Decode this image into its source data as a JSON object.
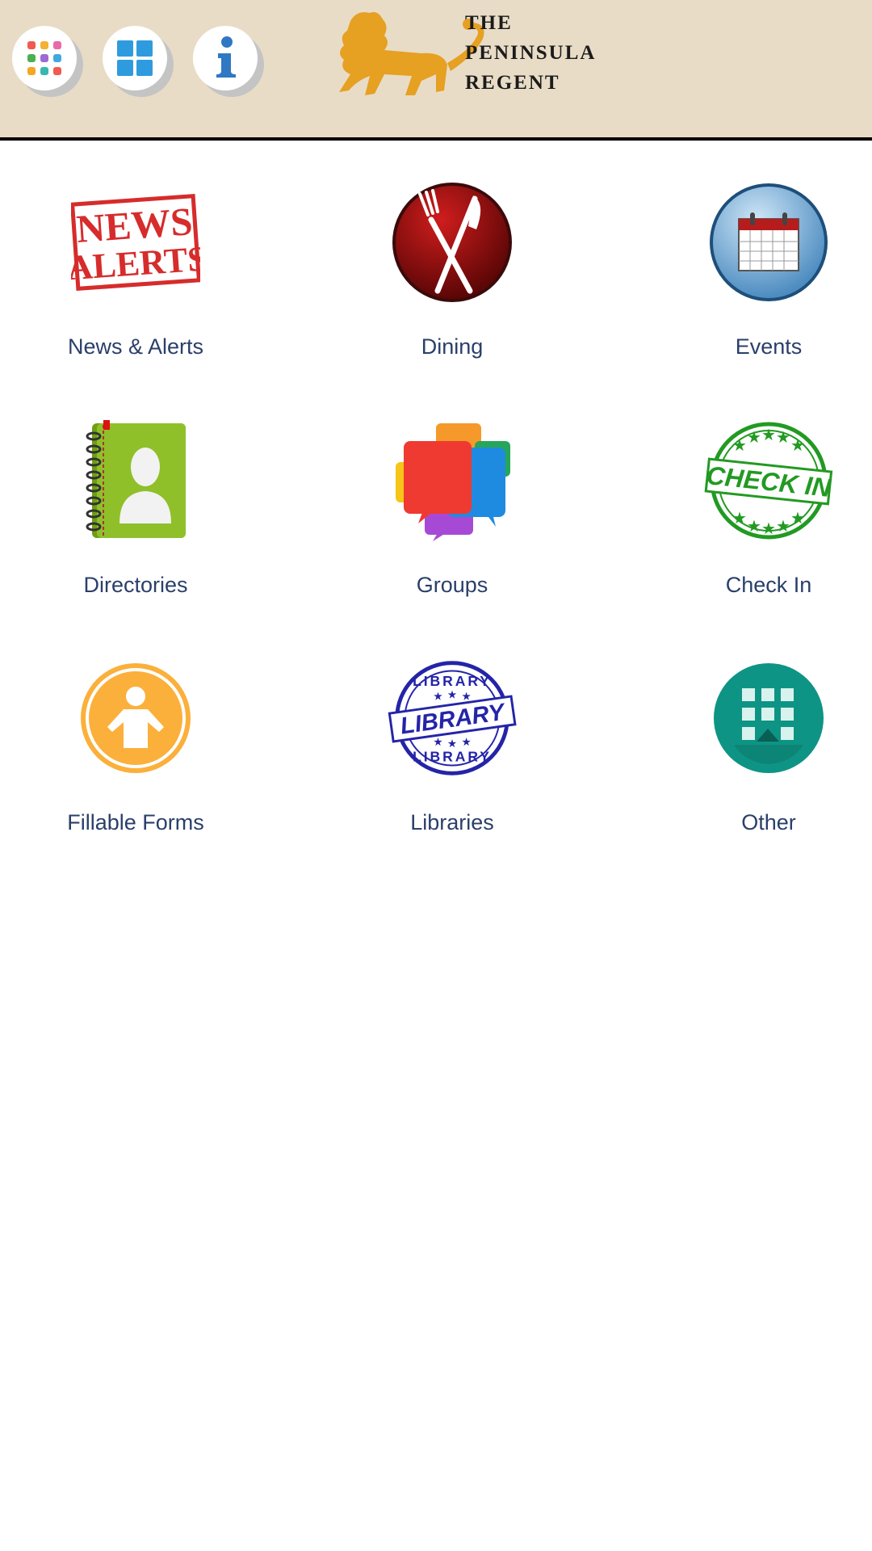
{
  "header": {
    "buttons": [
      {
        "icon": "apps-dots-icon"
      },
      {
        "icon": "grid-tiles-icon"
      },
      {
        "icon": "info-icon"
      }
    ],
    "logo_lines": [
      "THE",
      "PENINSULA",
      "REGENT"
    ],
    "logo_icon": "lion-icon",
    "background": "#e8dcc6"
  },
  "tiles": [
    {
      "label": "News & Alerts",
      "icon": "news-alerts-stamp-icon",
      "image_text": [
        "NEWS",
        "ALERTS"
      ]
    },
    {
      "label": "Dining",
      "icon": "fork-knife-icon"
    },
    {
      "label": "Events",
      "icon": "calendar-icon"
    },
    {
      "label": "Directories",
      "icon": "address-book-icon"
    },
    {
      "label": "Groups",
      "icon": "chat-bubbles-icon"
    },
    {
      "label": "Check In",
      "icon": "check-in-stamp-icon",
      "image_text": "CHECK IN"
    },
    {
      "label": "Fillable Forms",
      "icon": "person-form-icon"
    },
    {
      "label": "Libraries",
      "icon": "library-stamp-icon",
      "image_text": [
        "LIBRARY",
        "LIBRARY",
        "LIBRARY"
      ]
    },
    {
      "label": "Other",
      "icon": "other-grid-icon"
    }
  ],
  "colors": {
    "label": "#2a3f6a",
    "header_border": "#000000"
  }
}
